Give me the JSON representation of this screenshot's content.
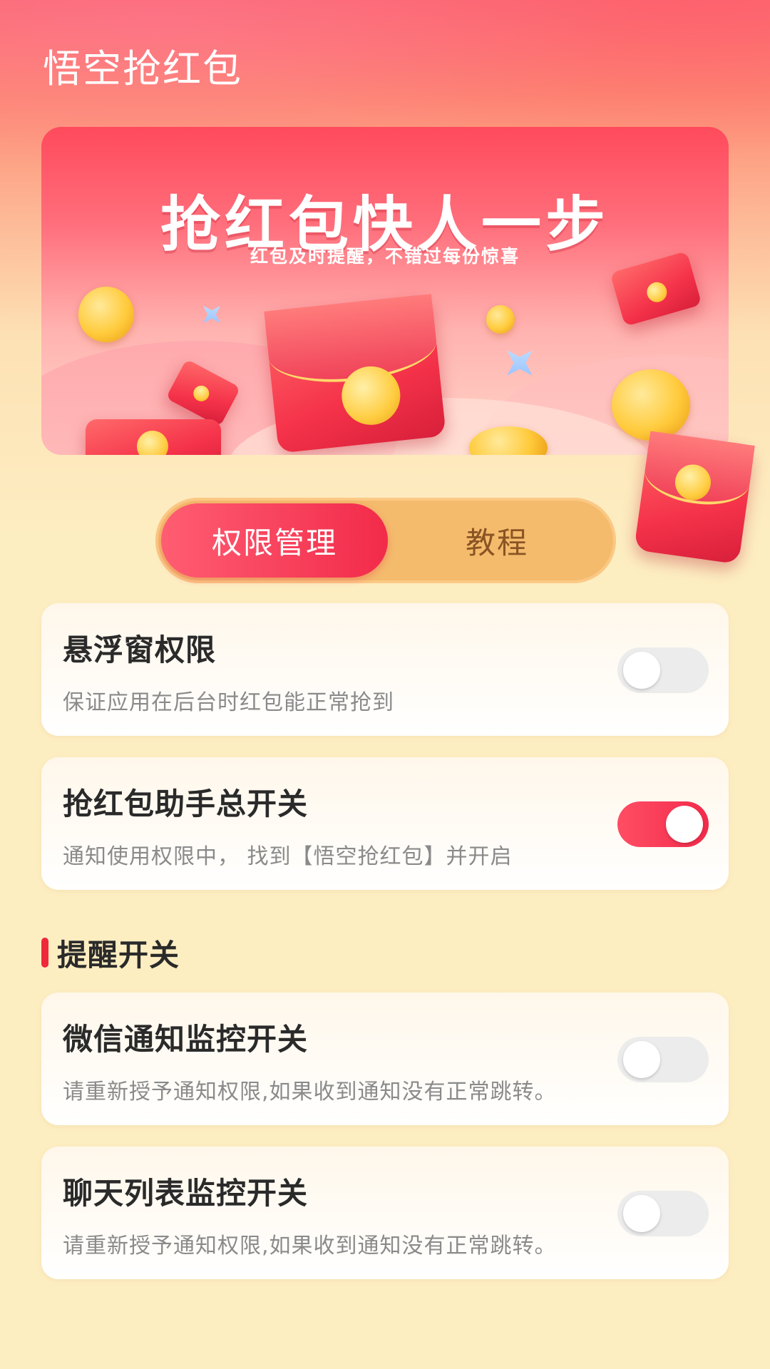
{
  "app": {
    "title": "悟空抢红包"
  },
  "banner": {
    "title": "抢红包快人一步",
    "subtitle": "红包及时提醒，不错过每份惊喜"
  },
  "tabs": [
    {
      "label": "权限管理",
      "active": true
    },
    {
      "label": "教程",
      "active": false
    }
  ],
  "permissions": [
    {
      "title": "悬浮窗权限",
      "desc": "保证应用在后台时红包能正常抢到",
      "enabled": false
    },
    {
      "title": "抢红包助手总开关",
      "desc": "通知使用权限中，  找到【悟空抢红包】并开启",
      "enabled": true
    }
  ],
  "reminder_section": {
    "title": "提醒开关"
  },
  "reminders": [
    {
      "title": "微信通知监控开关",
      "desc": "请重新授予通知权限,如果收到通知没有正常跳转。",
      "enabled": false
    },
    {
      "title": "聊天列表监控开关",
      "desc": "请重新授予通知权限,如果收到通知没有正常跳转。",
      "enabled": false
    }
  ],
  "colors": {
    "accent": "#f22b4a",
    "tab_bg": "#f4bb6d",
    "page_bg": "#fdeec2"
  }
}
